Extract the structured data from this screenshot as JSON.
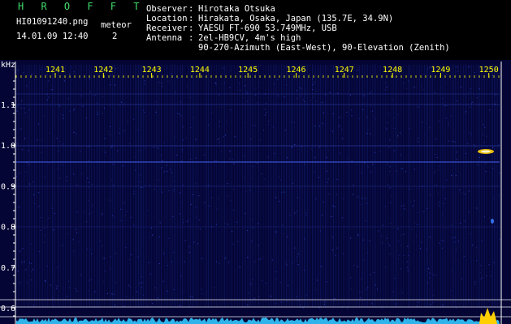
{
  "app": {
    "brand": "H R O F F T",
    "filename": "HI01091240.png",
    "datetime": "14.01.09 12:40",
    "meteor_label": "meteor",
    "meteor_count": "2"
  },
  "meta": {
    "observer_key": "Observer",
    "observer_val": "Hirotaka Otsuka",
    "location_key": "Location",
    "location_val": "Hirakata, Osaka, Japan (135.7E, 34.9N)",
    "receiver_key": "Receiver",
    "receiver_val": "YAESU FT-690 53.749MHz, USB",
    "antenna_key": "Antenna",
    "antenna_val": "2el-HB9CV, 4m's high",
    "antenna_val2": "90-270-Azimuth (East-West), 90-Elevation (Zenith)"
  },
  "chart_data": {
    "type": "heatmap",
    "ylabel": "kHz",
    "x_ticks": [
      "1241",
      "1242",
      "1243",
      "1244",
      "1245",
      "1246",
      "1247",
      "1248",
      "1249",
      "1250"
    ],
    "y_ticks": [
      "1.1",
      "1.0",
      "0.9",
      "0.8",
      "0.7",
      "0.6"
    ],
    "background_color": "#050535",
    "tick_color": "#ffff00",
    "axis_color": "#ffffff",
    "signal_color": "#2a5cff",
    "meteor_color": "#ffd000"
  }
}
